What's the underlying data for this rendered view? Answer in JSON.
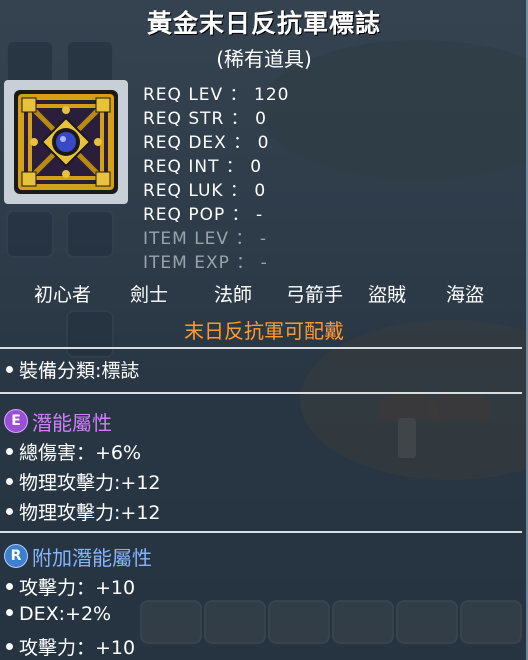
{
  "item": {
    "name": "黃金末日反抗軍標誌",
    "rarity": "(稀有道具)",
    "icon": "golden-emblem-icon",
    "colors": {
      "gold": "#d4a017",
      "gem": "#3848c8",
      "frame": "#c8cfd6"
    }
  },
  "requirements": [
    {
      "label": "REQ LEV",
      "sep": "：",
      "value": "120",
      "active": true
    },
    {
      "label": "REQ STR",
      "sep": "：",
      "value": "0",
      "active": true
    },
    {
      "label": "REQ DEX",
      "sep": "：",
      "value": "0",
      "active": true
    },
    {
      "label": "REQ INT",
      "sep": "：",
      "value": "0",
      "active": true
    },
    {
      "label": "REQ LUK",
      "sep": "：",
      "value": "0",
      "active": true
    },
    {
      "label": "REQ POP",
      "sep": "：",
      "value": "-",
      "active": true
    },
    {
      "label": "ITEM LEV",
      "sep": "：",
      "value": "-",
      "active": false
    },
    {
      "label": "ITEM EXP",
      "sep": "：",
      "value": "-",
      "active": false
    }
  ],
  "jobs": [
    "初心者",
    "劍士",
    "法師",
    "弓箭手",
    "盜賊",
    "海盜"
  ],
  "equip_note": "末日反抗軍可配戴",
  "equip_category": "裝備分類:標誌",
  "potential": {
    "badge": "E",
    "title": "潛能屬性",
    "color": "#d27cff",
    "lines": [
      "總傷害：+6%",
      "物理攻擊力:+12",
      "物理攻擊力:+12"
    ]
  },
  "bonus_potential": {
    "badge": "R",
    "title": "附加潛能屬性",
    "color": "#86b4ff",
    "lines": [
      "攻擊力：+10",
      "DEX:+2%",
      "攻擊力：+10"
    ]
  }
}
